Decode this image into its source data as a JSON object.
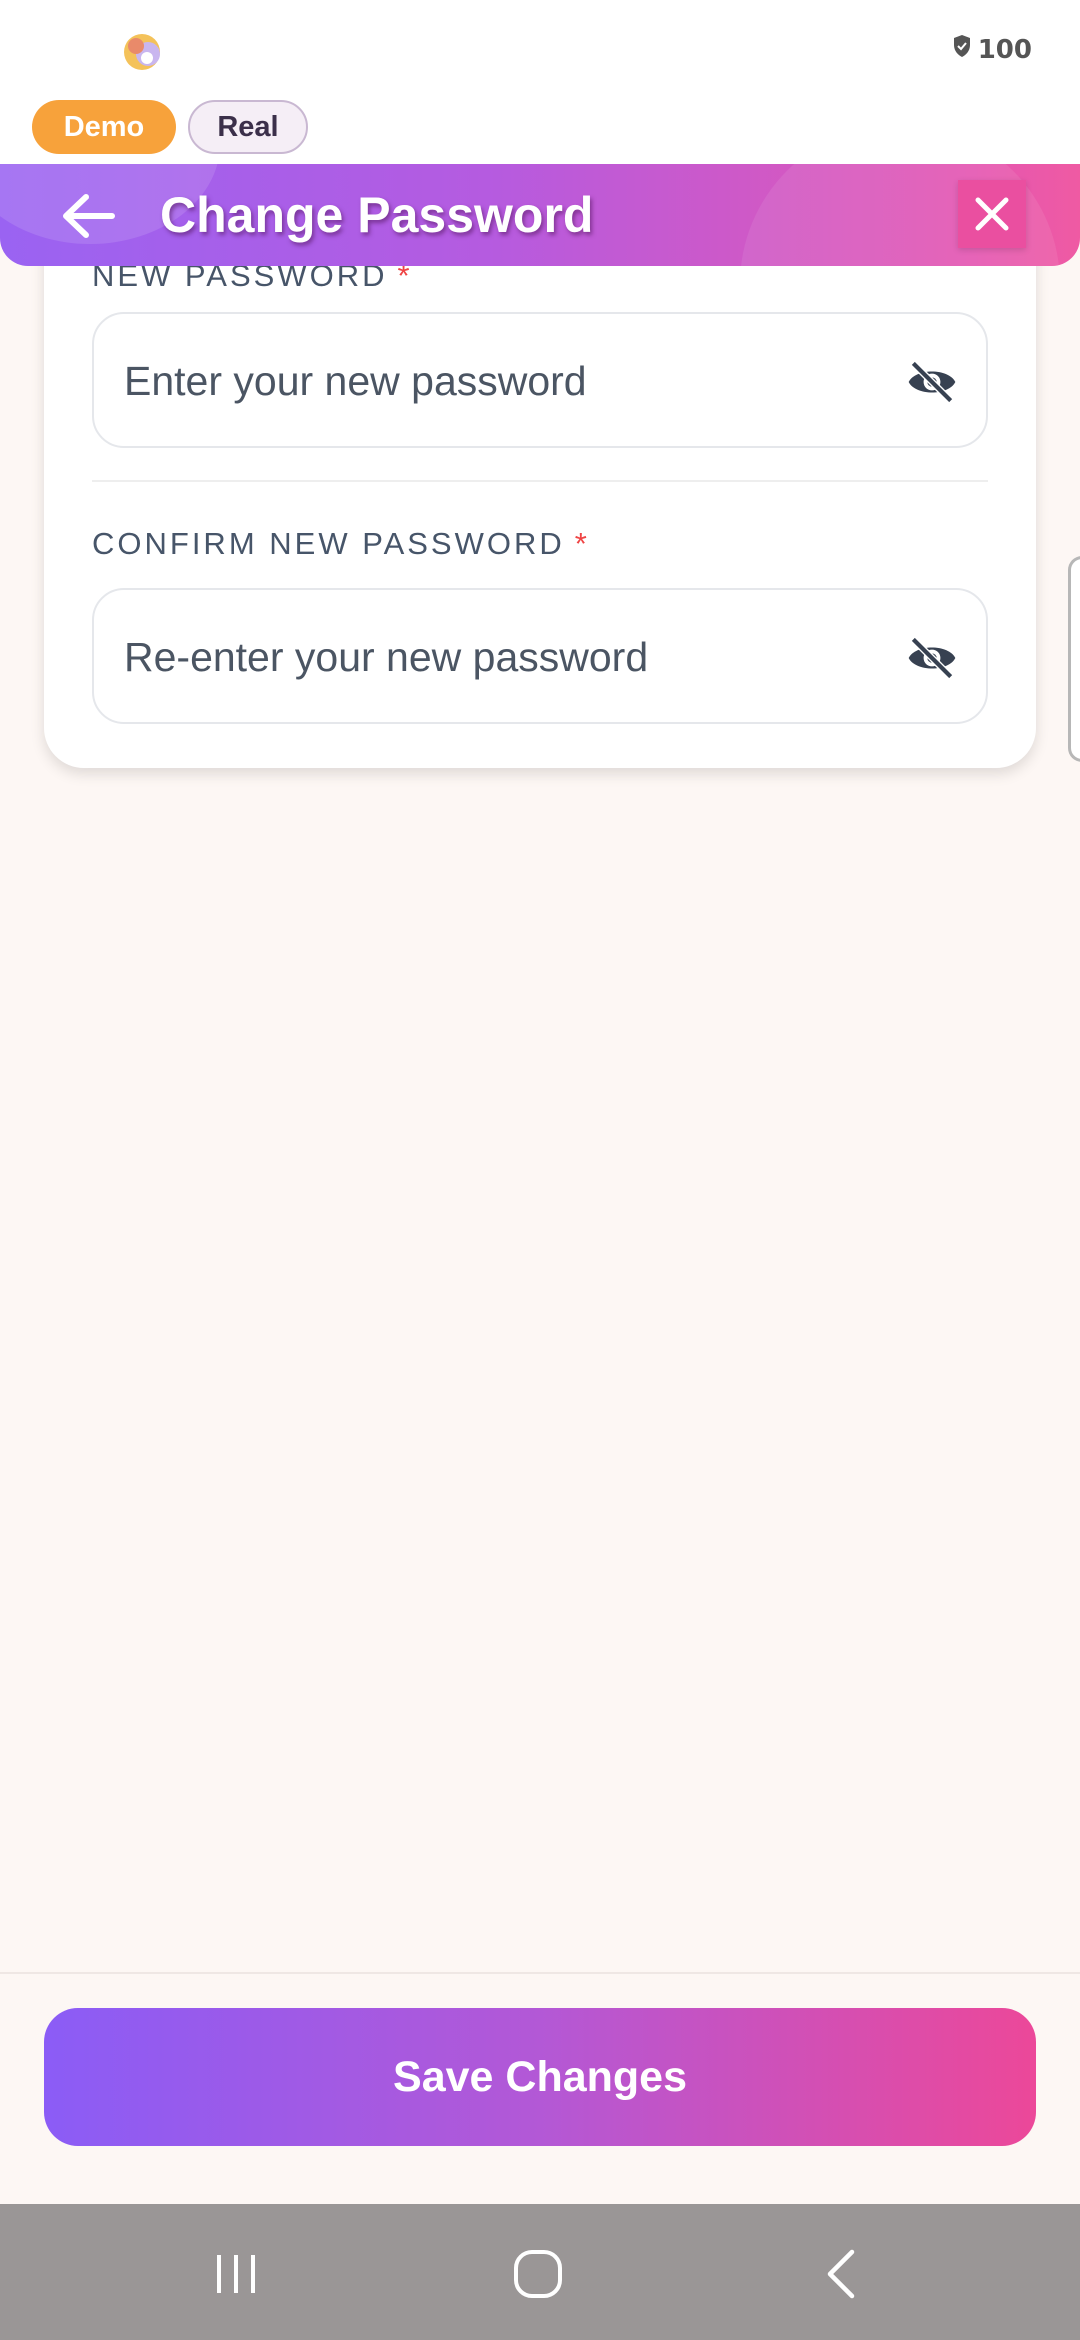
{
  "status_bar": {
    "battery_level": "100",
    "battery_icon": "shield-battery-icon",
    "app_icon": "app-logo-icon"
  },
  "mode_toggle": {
    "demo_label": "Demo",
    "real_label": "Real",
    "selected": "Demo"
  },
  "header": {
    "title": "Change Password",
    "back_icon": "arrow-left-icon",
    "close_icon": "close-icon"
  },
  "form": {
    "new_password": {
      "label": "NEW PASSWORD",
      "required_mark": "*",
      "placeholder": "Enter your new password",
      "value": "",
      "visibility_icon": "eye-off-icon"
    },
    "confirm_password": {
      "label": "CONFIRM NEW PASSWORD",
      "required_mark": "*",
      "placeholder": "Re-enter your new password",
      "value": "",
      "visibility_icon": "eye-off-icon"
    }
  },
  "footer": {
    "save_label": "Save Changes"
  },
  "navigation": {
    "recents_icon": "recents-icon",
    "home_icon": "home-icon",
    "back_icon": "back-chevron-icon"
  },
  "colors": {
    "gradient_start": "#9a63f2",
    "gradient_end": "#ef5aa3",
    "demo_chip": "#f7a23b",
    "required": "#ef4444",
    "background": "#fdf7f4"
  }
}
